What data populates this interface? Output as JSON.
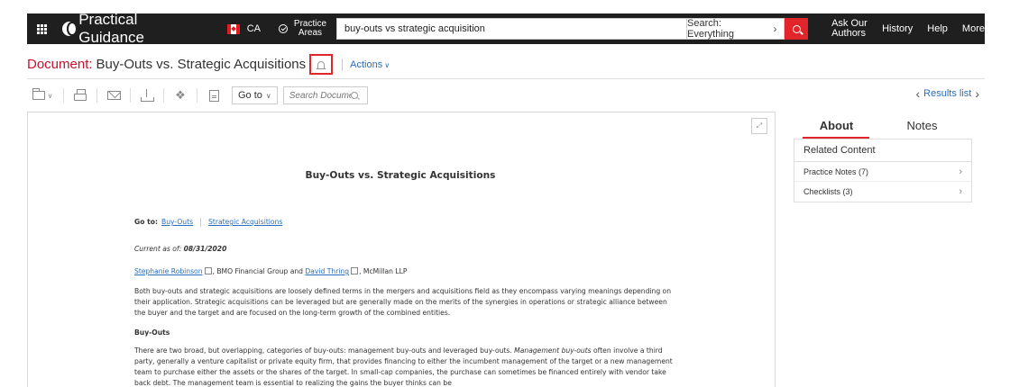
{
  "header": {
    "brand": "Practical Guidance",
    "jurisdiction": "CA",
    "practice_areas": "Practice Areas",
    "search_value": "buy-outs vs strategic acquisition",
    "search_scope": "Search: Everything",
    "ask_authors": "Ask Our Authors",
    "history": "History",
    "help": "Help",
    "more": "More"
  },
  "document": {
    "prefix": "Document:",
    "title": "Buy-Outs vs. Strategic Acquisitions",
    "actions": "Actions"
  },
  "toolbar": {
    "goto": "Go to",
    "search_placeholder": "Search Document",
    "results_list": "Results list"
  },
  "content": {
    "heading": "Buy-Outs vs. Strategic Acquisitions",
    "goto_label": "Go to:",
    "goto_links": [
      "Buy-Outs",
      "Strategic Acquisitions"
    ],
    "current_label": "Current as of:",
    "current_date": "08/31/2020",
    "author1": "Stephanie Robinson",
    "author1_org": ", BMO Financial Group and ",
    "author2": "David Thring",
    "author2_org": ", McMillan LLP",
    "paragraph1": "Both buy-outs and strategic acquisitions are loosely defined terms in the mergers and acquisitions field as they encompass varying meanings depending on their application. Strategic acquisitions can be leveraged but are generally made on the merits of the synergies in operations or strategic alliance between the buyer and the target and are focused on the long-term growth of the combined entities.",
    "section_buyouts": "Buy-Outs",
    "paragraph2_start": "There are two broad, but overlapping, categories of buy-outs: management buy-outs and leveraged buy-outs. ",
    "paragraph2_em": "Management buy-outs",
    "paragraph2_rest": " often involve a third party, generally a venture capitalist or private equity firm, that provides financing to either the incumbent management of the target or a new management team to purchase either the assets or the shares of the target. In small-cap companies, the purchase can sometimes be financed entirely with vendor take back debt. The management team is essential to realizing the gains the buyer thinks can be"
  },
  "side": {
    "tab_about": "About",
    "tab_notes": "Notes",
    "related_content": "Related Content",
    "rows": [
      "Practice Notes (7)",
      "Checklists (3)"
    ]
  }
}
